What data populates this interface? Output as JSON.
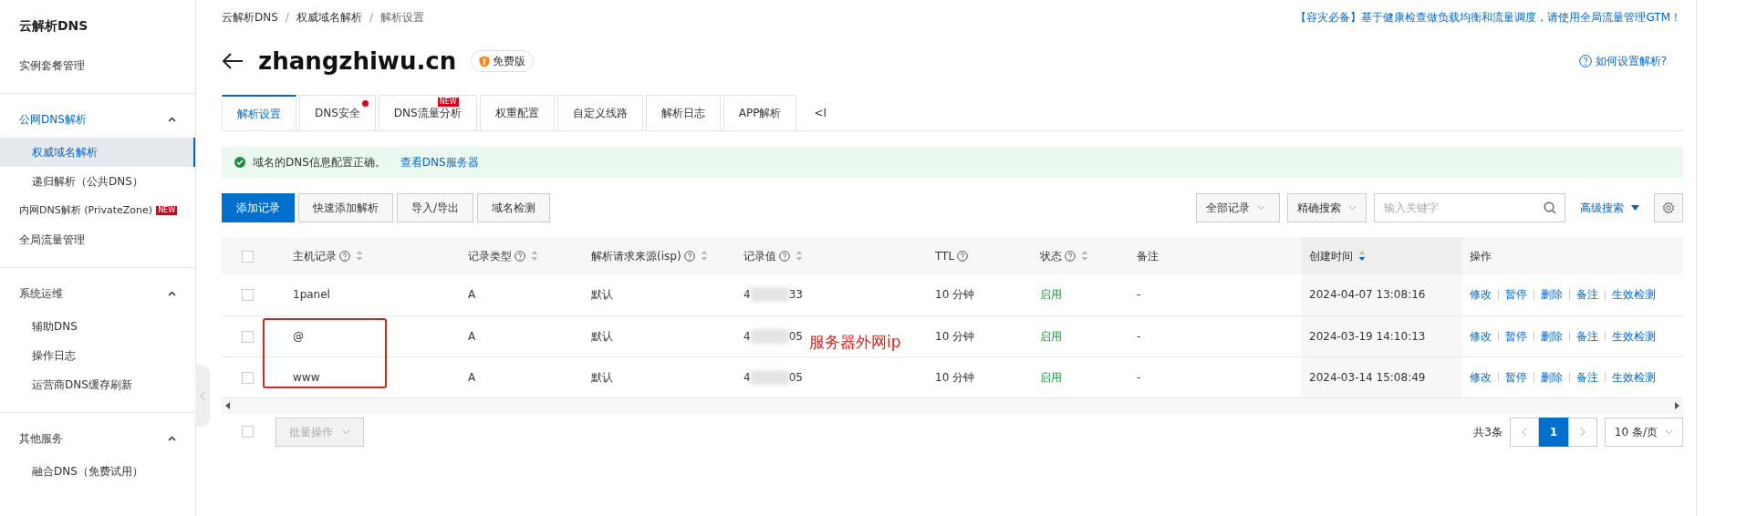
{
  "sidebar": {
    "title": "云解析DNS",
    "top_items": [
      {
        "label": "实例套餐管理"
      }
    ],
    "groups": [
      {
        "label": "公网DNS解析",
        "expanded": true,
        "selected": true,
        "items": [
          {
            "label": "权威域名解析",
            "selected": true,
            "sub": true
          },
          {
            "label": "递归解析（公共DNS）",
            "selected": false,
            "sub": true
          },
          {
            "label": "内网DNS解析 (PrivateZone)",
            "selected": false,
            "sub": false,
            "badge": "NEW"
          },
          {
            "label": "全局流量管理",
            "selected": false,
            "sub": false
          }
        ]
      },
      {
        "label": "系统运维",
        "expanded": true,
        "selected": false,
        "items": [
          {
            "label": "辅助DNS",
            "selected": false,
            "sub": true
          },
          {
            "label": "操作日志",
            "selected": false,
            "sub": true
          },
          {
            "label": "运营商DNS缓存刷新",
            "selected": false,
            "sub": true
          }
        ]
      },
      {
        "label": "其他服务",
        "expanded": true,
        "selected": false,
        "items": [
          {
            "label": "融合DNS（免费试用）",
            "selected": false,
            "sub": true
          }
        ]
      }
    ]
  },
  "breadcrumb": [
    "云解析DNS",
    "权威域名解析",
    "解析设置"
  ],
  "breadcrumb_separator": "/",
  "promo": "【容灾必备】基于健康检查做负载均衡和流量调度，请使用全局流量管理GTM！",
  "domain": "zhangzhiwu.cn",
  "edition": "免费版",
  "help_link": "如何设置解析?",
  "tabs": [
    {
      "label": "解析设置",
      "selected": true
    },
    {
      "label": "DNS安全",
      "selected": false,
      "dot": true
    },
    {
      "label": "DNS流量分析",
      "selected": false,
      "badge": "NEW"
    },
    {
      "label": "权重配置",
      "selected": false
    },
    {
      "label": "自定义线路",
      "selected": false
    },
    {
      "label": "解析日志",
      "selected": false
    },
    {
      "label": "APP解析",
      "selected": false
    },
    {
      "label": "<I",
      "selected": false
    }
  ],
  "alert": {
    "text": "域名的DNS信息配置正确。",
    "link": "查看DNS服务器"
  },
  "actions": [
    "添加记录",
    "快速添加解析",
    "导入/导出",
    "域名检测"
  ],
  "filter": {
    "type": "全部记录",
    "mode": "精确搜索",
    "placeholder": "输入关键字",
    "advanced": "高级搜索"
  },
  "table": {
    "select_all_checked": false,
    "columns": [
      {
        "label": "主机记录",
        "help": true,
        "sort": true
      },
      {
        "label": "记录类型",
        "help": true,
        "sort": true
      },
      {
        "label": "解析请求来源(isp)",
        "help": true,
        "sort": true
      },
      {
        "label": "记录值",
        "help": true,
        "sort": true
      },
      {
        "label": "TTL",
        "help": true,
        "sort": false
      },
      {
        "label": "状态",
        "help": true,
        "sort": true
      },
      {
        "label": "备注",
        "help": false,
        "sort": false
      },
      {
        "label": "创建时间",
        "help": false,
        "sort": true
      },
      {
        "label": "操作",
        "help": false,
        "sort": false
      }
    ],
    "rows": [
      {
        "checked": false,
        "host": "1panel",
        "type": "A",
        "isp": "默认",
        "value_start": "4",
        "value_end": "33",
        "ttl": "10 分钟",
        "status": "启用",
        "note": "-",
        "created": "2024-04-07 13:08:16",
        "ops": [
          "修改",
          "暂停",
          "删除",
          "备注",
          "生效检测"
        ]
      },
      {
        "checked": false,
        "host": "@",
        "type": "A",
        "isp": "默认",
        "value_start": "4",
        "value_end": "05",
        "ttl": "10 分钟",
        "status": "启用",
        "note": "-",
        "created": "2024-03-19 14:10:13",
        "ops": [
          "修改",
          "暂停",
          "删除",
          "备注",
          "生效检测"
        ]
      },
      {
        "checked": false,
        "host": "www",
        "type": "A",
        "isp": "默认",
        "value_start": "4",
        "value_end": "05",
        "ttl": "10 分钟",
        "status": "启用",
        "note": "-",
        "created": "2024-03-14 15:08:49",
        "ops": [
          "修改",
          "暂停",
          "删除",
          "备注",
          "生效检测"
        ]
      }
    ]
  },
  "annotation": "服务器外网ip",
  "footer": {
    "select_all_checked": false,
    "bulk": "批量操作",
    "total": "共3条",
    "pages": [
      {
        "label": "1",
        "selected": true
      }
    ],
    "page_size": "10 条/页"
  }
}
